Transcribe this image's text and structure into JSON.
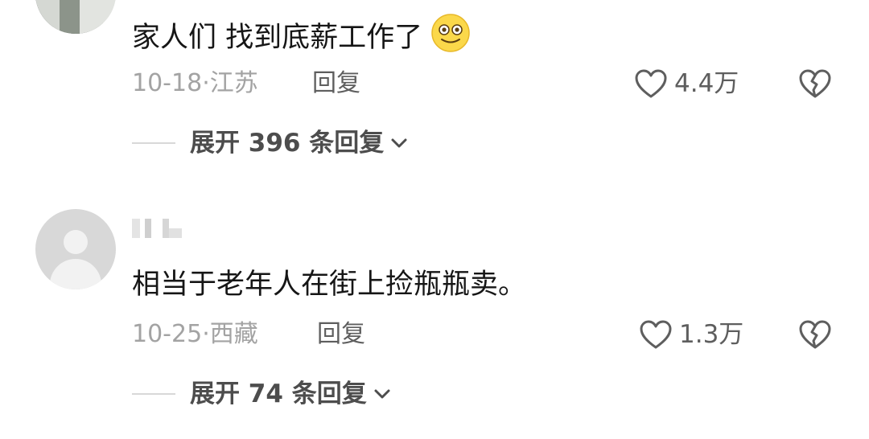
{
  "comments": [
    {
      "text": "家人们 找到底薪工作了",
      "emoji": "smiling-face-emoji",
      "date": "10-18",
      "location": "江苏",
      "reply_label": "回复",
      "likes": "4.4万",
      "expand_label": "展开 396 条回复"
    },
    {
      "text": "相当于老年人在街上捡瓶瓶卖。",
      "date": "10-25",
      "location": "西藏",
      "reply_label": "回复",
      "likes": "1.3万",
      "expand_label": "展开 74 条回复"
    }
  ],
  "meta_separator": "·",
  "icons": {
    "like": "heart-outline-icon",
    "dislike": "broken-heart-icon",
    "expand": "chevron-down-icon"
  },
  "colors": {
    "primary_text": "#161616",
    "secondary_text": "#a3a3a3",
    "action_text": "#5e5e5e"
  }
}
